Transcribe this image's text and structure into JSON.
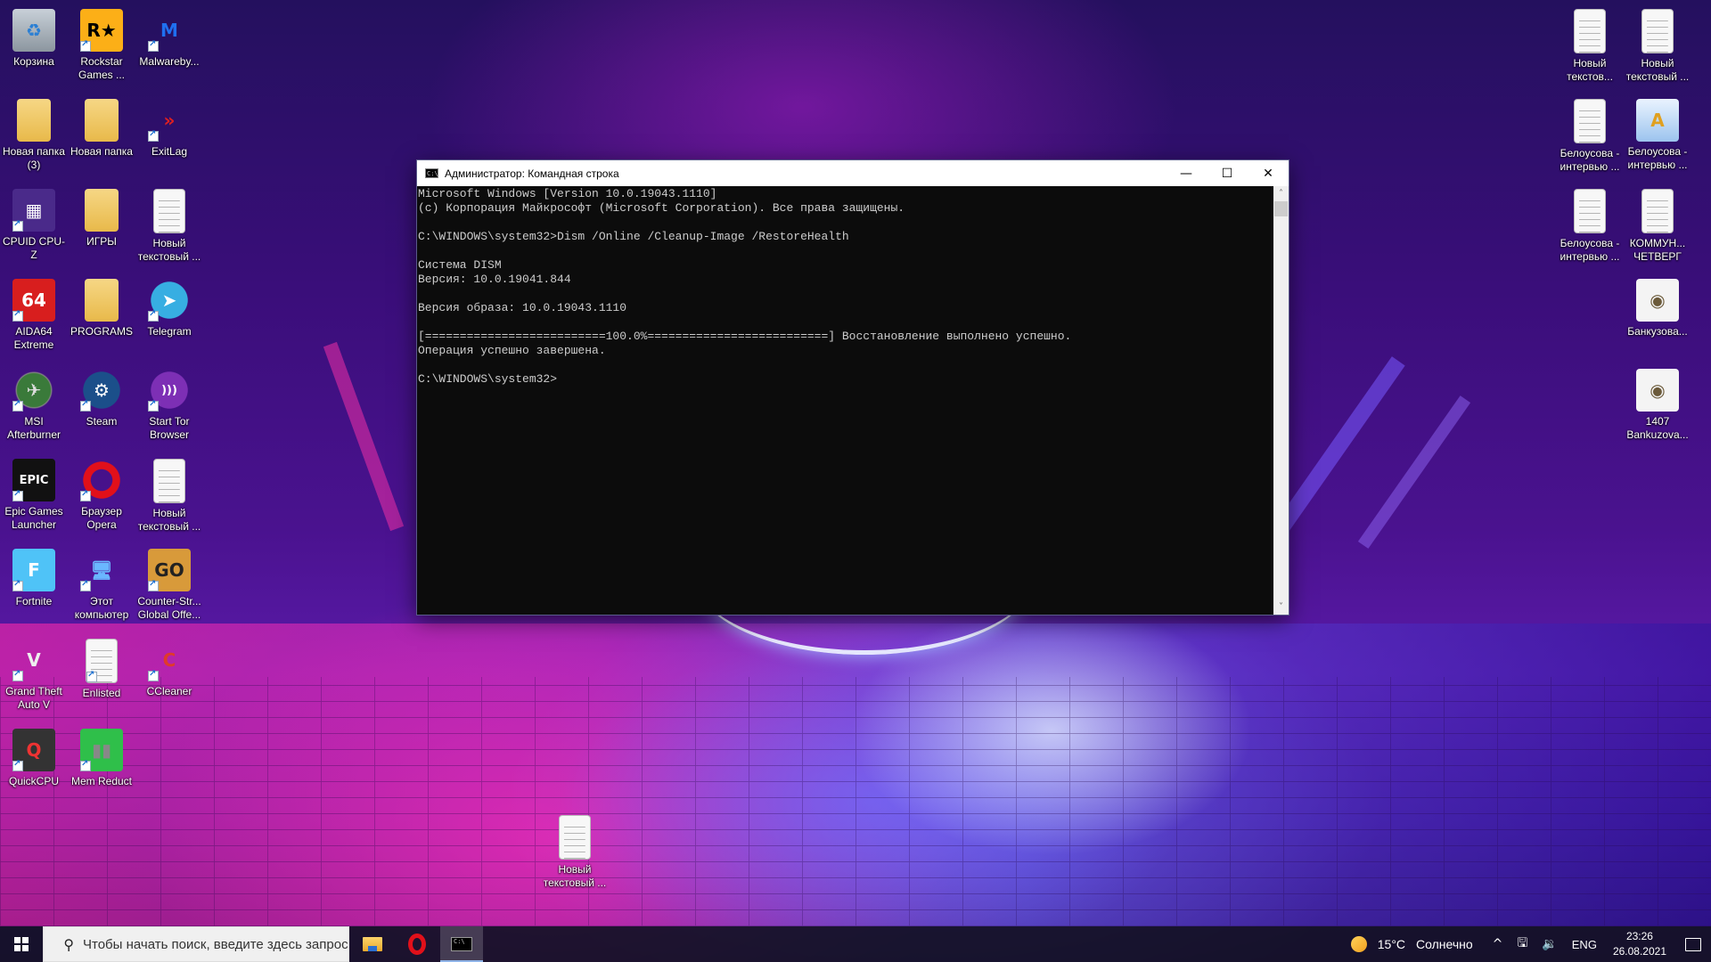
{
  "desktop": {
    "left_icons": [
      {
        "label": "Корзина",
        "icon": "recycle-bin-icon",
        "shortcut": false
      },
      {
        "label": "Rockstar Games ...",
        "icon": "rockstar-icon",
        "shortcut": true
      },
      {
        "label": "Malwareby...",
        "icon": "malwarebytes-icon",
        "shortcut": true
      },
      {
        "label": "Новая папка (3)",
        "icon": "folder-icon",
        "shortcut": false
      },
      {
        "label": "Новая папка",
        "icon": "folder-icon",
        "shortcut": false
      },
      {
        "label": "ExitLag",
        "icon": "exitlag-icon",
        "shortcut": true
      },
      {
        "label": "CPUID CPU-Z",
        "icon": "cpuz-icon",
        "shortcut": true
      },
      {
        "label": "ИГРЫ",
        "icon": "folder-icon",
        "shortcut": false
      },
      {
        "label": "Новый текстовый ...",
        "icon": "text-document-icon",
        "shortcut": false
      },
      {
        "label": "AIDA64 Extreme",
        "icon": "aida64-icon",
        "shortcut": true
      },
      {
        "label": "PROGRAMS",
        "icon": "folder-icon",
        "shortcut": false
      },
      {
        "label": "Telegram",
        "icon": "telegram-icon",
        "shortcut": true
      },
      {
        "label": "MSI Afterburner",
        "icon": "msi-afterburner-icon",
        "shortcut": true
      },
      {
        "label": "Steam",
        "icon": "steam-icon",
        "shortcut": true
      },
      {
        "label": "Start Tor Browser",
        "icon": "tor-browser-icon",
        "shortcut": true
      },
      {
        "label": "Epic Games Launcher",
        "icon": "epic-games-icon",
        "shortcut": true
      },
      {
        "label": "Браузер Opera",
        "icon": "opera-icon",
        "shortcut": true
      },
      {
        "label": "Новый текстовый ...",
        "icon": "text-document-icon",
        "shortcut": false
      },
      {
        "label": "Fortnite",
        "icon": "fortnite-icon",
        "shortcut": true
      },
      {
        "label": "Этот компьютер",
        "icon": "this-pc-icon",
        "shortcut": true
      },
      {
        "label": "Counter-Str... Global Offe...",
        "icon": "csgo-icon",
        "shortcut": true
      },
      {
        "label": "Grand Theft Auto V",
        "icon": "gta-v-icon",
        "shortcut": true
      },
      {
        "label": "Enlisted",
        "icon": "blank-document-icon",
        "shortcut": true
      },
      {
        "label": "CCleaner",
        "icon": "ccleaner-icon",
        "shortcut": true
      },
      {
        "label": "QuickCPU",
        "icon": "quickcpu-icon",
        "shortcut": true
      },
      {
        "label": "Mem Reduct",
        "icon": "mem-reduct-icon",
        "shortcut": true
      }
    ],
    "right_icons": [
      {
        "label": "Новый текстов...",
        "icon": "text-document-icon"
      },
      {
        "label": "Новый текстовый ...",
        "icon": "text-document-icon"
      },
      {
        "label": "Белоусова - интервью ...",
        "icon": "text-document-icon"
      },
      {
        "label": "Белоусова - интервью ...",
        "icon": "wordpad-document-icon"
      },
      {
        "label": "Белоусова - интервью ...",
        "icon": "document-icon"
      },
      {
        "label": "КОММУН... ЧЕТВЕРГ",
        "icon": "document-icon"
      },
      {
        "label": "Банкузова...",
        "icon": "audio-file-icon"
      },
      {
        "label": "1407 Bankuzova...",
        "icon": "audio-file-icon"
      }
    ],
    "floating_icon": {
      "label": "Новый текстовый ...",
      "icon": "text-document-icon"
    }
  },
  "cmd_window": {
    "title": "Администратор: Командная строка",
    "icon_text": "C:\\",
    "buttons": {
      "minimize": "—",
      "maximize": "☐",
      "close": "✕"
    },
    "lines": [
      "Microsoft Windows [Version 10.0.19043.1110]",
      "(c) Корпорация Майкрософт (Microsoft Corporation). Все права защищены.",
      "",
      "C:\\WINDOWS\\system32>Dism /Online /Cleanup-Image /RestoreHealth",
      "",
      "Система DISM",
      "Версия: 10.0.19041.844",
      "",
      "Версия образа: 10.0.19043.1110",
      "",
      "[==========================100.0%==========================] Восстановление выполнено успешно.",
      "Операция успешно завершена.",
      "",
      "C:\\WINDOWS\\system32>"
    ],
    "scroll_up": "˄",
    "scroll_down": "˅"
  },
  "taskbar": {
    "search_placeholder": "Чтобы начать поиск, введите здесь запрос",
    "pinned": [
      {
        "name": "File Explorer",
        "icon": "file-explorer-icon",
        "active": false
      },
      {
        "name": "Opera",
        "icon": "opera-icon",
        "active": false
      },
      {
        "name": "Командная строка",
        "icon": "cmd-icon",
        "active": true
      }
    ],
    "weather": {
      "temp": "15°C",
      "condition": "Солнечно"
    },
    "tray_chevron": "^",
    "language": "ENG",
    "time": "23:26",
    "date": "26.08.2021"
  },
  "colors": {
    "cmd_background": "#0c0c0c",
    "cmd_text": "#cccccc",
    "taskbar": "#16122a",
    "accent": "#8fb4e8"
  }
}
